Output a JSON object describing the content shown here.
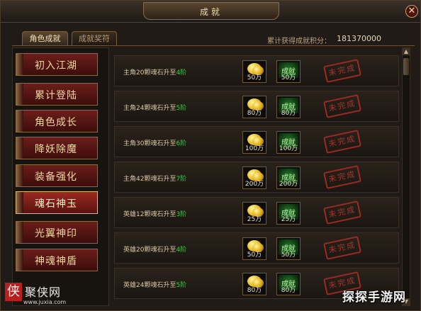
{
  "window": {
    "title": "成就"
  },
  "tabs": [
    {
      "label": "角色成就",
      "active": true
    },
    {
      "label": "成就奖符",
      "active": false
    }
  ],
  "score": {
    "label": "累计获得成就积分：",
    "value": "181370000"
  },
  "sidebar": {
    "items": [
      {
        "label": "初入江湖"
      },
      {
        "label": "累计登陆"
      },
      {
        "label": "角色成长"
      },
      {
        "label": "降妖除魔"
      },
      {
        "label": "装备强化"
      },
      {
        "label": "魂石神玉"
      },
      {
        "label": "光翼神印"
      },
      {
        "label": "神魂神盾"
      }
    ],
    "active_index": 5
  },
  "achievements": [
    {
      "desc": "主角20颗魂石升至",
      "level": "4阶",
      "coin": "50万",
      "ach": "50万",
      "ach_icon_text": "成就",
      "status": "未完成"
    },
    {
      "desc": "主角24颗魂石升至",
      "level": "5阶",
      "coin": "80万",
      "ach": "80万",
      "ach_icon_text": "成就",
      "status": "未完成"
    },
    {
      "desc": "主角30颗魂石升至",
      "level": "6阶",
      "coin": "100万",
      "ach": "100万",
      "ach_icon_text": "成就",
      "status": "未完成"
    },
    {
      "desc": "主角42颗魂石升至",
      "level": "7阶",
      "coin": "200万",
      "ach": "200万",
      "ach_icon_text": "成就",
      "status": "未完成"
    },
    {
      "desc": "英雄12颗魂石升至",
      "level": "3阶",
      "coin": "25万",
      "ach": "25万",
      "ach_icon_text": "成就",
      "status": "未完成"
    },
    {
      "desc": "英雄20颗魂石升至",
      "level": "4阶",
      "coin": "50万",
      "ach": "50万",
      "ach_icon_text": "成就",
      "status": "未完成"
    },
    {
      "desc": "英雄24颗魂石升至",
      "level": "5阶",
      "coin": "80万",
      "ach": "80万",
      "ach_icon_text": "成就",
      "status": "未完成"
    }
  ],
  "watermarks": {
    "site_seal": "侠",
    "site_name": "聚侠网",
    "site_url": "www.juxia.com",
    "right_text": "探探手游网"
  },
  "colors": {
    "level_text": "#31d43d",
    "stamp": "#a8342a",
    "active_tab_text": "#f4e2b8"
  }
}
